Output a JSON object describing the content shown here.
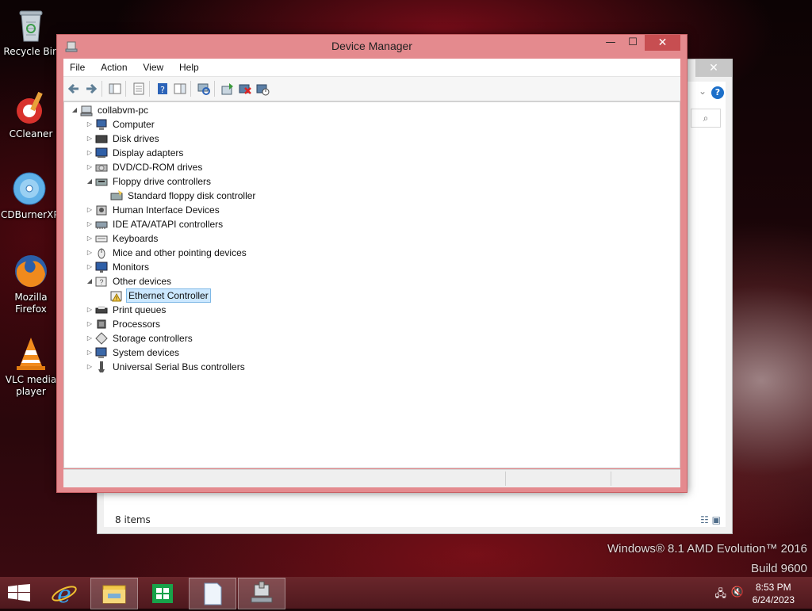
{
  "wallpaper": {
    "edition": "Windows® 8.1 AMD Evolution™ 2016",
    "build": "Build 9600"
  },
  "desktop_icons": [
    {
      "label": "Recycle Bin",
      "icon": "recycle-bin-icon"
    },
    {
      "label": "CCleaner",
      "icon": "ccleaner-icon"
    },
    {
      "label": "CDBurnerXP",
      "icon": "cdburnerxp-icon"
    },
    {
      "label": "Mozilla Firefox",
      "icon": "firefox-icon"
    },
    {
      "label": "VLC media player",
      "icon": "vlc-icon"
    }
  ],
  "explorer": {
    "status": "8 items",
    "close": "✕"
  },
  "device_manager": {
    "title": "Device Manager",
    "controls": {
      "minimize": "—",
      "maximize": "☐",
      "close": "✕"
    },
    "menu": [
      "File",
      "Action",
      "View",
      "Help"
    ],
    "toolbar": [
      "back-icon",
      "forward-icon",
      "show-hide-tree-icon",
      "properties-icon",
      "help-icon",
      "action-pane-icon",
      "scan-hardware-icon",
      "update-driver-icon",
      "uninstall-icon",
      "disable-icon"
    ],
    "tree": {
      "root": "collabvm-pc",
      "items": [
        {
          "label": "Computer",
          "expanded": false
        },
        {
          "label": "Disk drives",
          "expanded": false
        },
        {
          "label": "Display adapters",
          "expanded": false
        },
        {
          "label": "DVD/CD-ROM drives",
          "expanded": false
        },
        {
          "label": "Floppy drive controllers",
          "expanded": true,
          "children": [
            "Standard floppy disk controller"
          ]
        },
        {
          "label": "Human Interface Devices",
          "expanded": false
        },
        {
          "label": "IDE ATA/ATAPI controllers",
          "expanded": false
        },
        {
          "label": "Keyboards",
          "expanded": false
        },
        {
          "label": "Mice and other pointing devices",
          "expanded": false
        },
        {
          "label": "Monitors",
          "expanded": false
        },
        {
          "label": "Other devices",
          "expanded": true,
          "children": [
            "Ethernet Controller"
          ]
        },
        {
          "label": "Print queues",
          "expanded": false
        },
        {
          "label": "Processors",
          "expanded": false
        },
        {
          "label": "Storage controllers",
          "expanded": false
        },
        {
          "label": "System devices",
          "expanded": false
        },
        {
          "label": "Universal Serial Bus controllers",
          "expanded": false
        }
      ],
      "selected": "Ethernet Controller"
    }
  },
  "taskbar": {
    "pinned": [
      "internet-explorer-icon",
      "file-explorer-icon",
      "store-icon",
      "notepad-icon",
      "device-manager-icon"
    ],
    "time": "8:53 PM",
    "date": "6/24/2023"
  }
}
